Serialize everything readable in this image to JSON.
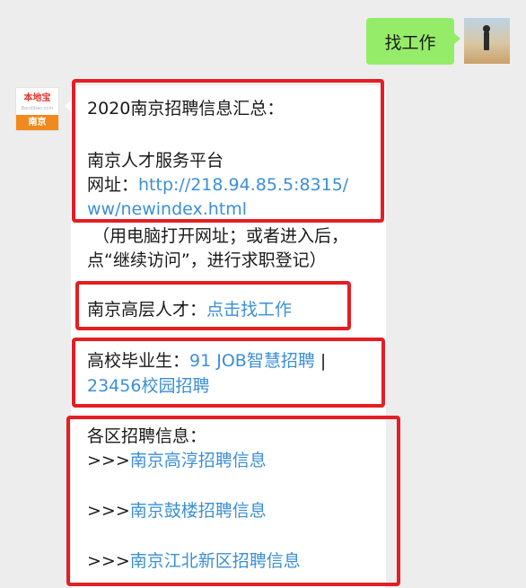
{
  "user_message": {
    "text": "找工作"
  },
  "bot_avatar": {
    "logo_text": "本地宝",
    "logo_subtext": "Bendibao.com",
    "city": "南京"
  },
  "reply": {
    "summary_title": "2020南京招聘信息汇总：",
    "platform_name": "南京人才服务平台",
    "url_label": "网址：",
    "url_line1": "http://218.94.85.5:8315/",
    "url_line2": "ww/newindex.html",
    "note_line1": "（用电脑打开网址；或者进入后，",
    "note_line2": "点“继续访问”，进行求职登记）",
    "senior_label": "南京高层人才：",
    "senior_link": "点击找工作",
    "grad_label": "高校毕业生：",
    "grad_link1": "91 JOB智慧招聘",
    "grad_separator": "  |",
    "grad_link2": "23456校园招聘",
    "district_title": "各区招聘信息：",
    "arrow_prefix": ">>>",
    "district_links": [
      "南京高淳招聘信息",
      "南京鼓楼招聘信息",
      "南京江北新区招聘信息"
    ]
  },
  "colors": {
    "link": "#3c8fd5",
    "highlight_border": "#e31e24",
    "user_bubble": "#95ec69",
    "background": "#ededed"
  }
}
